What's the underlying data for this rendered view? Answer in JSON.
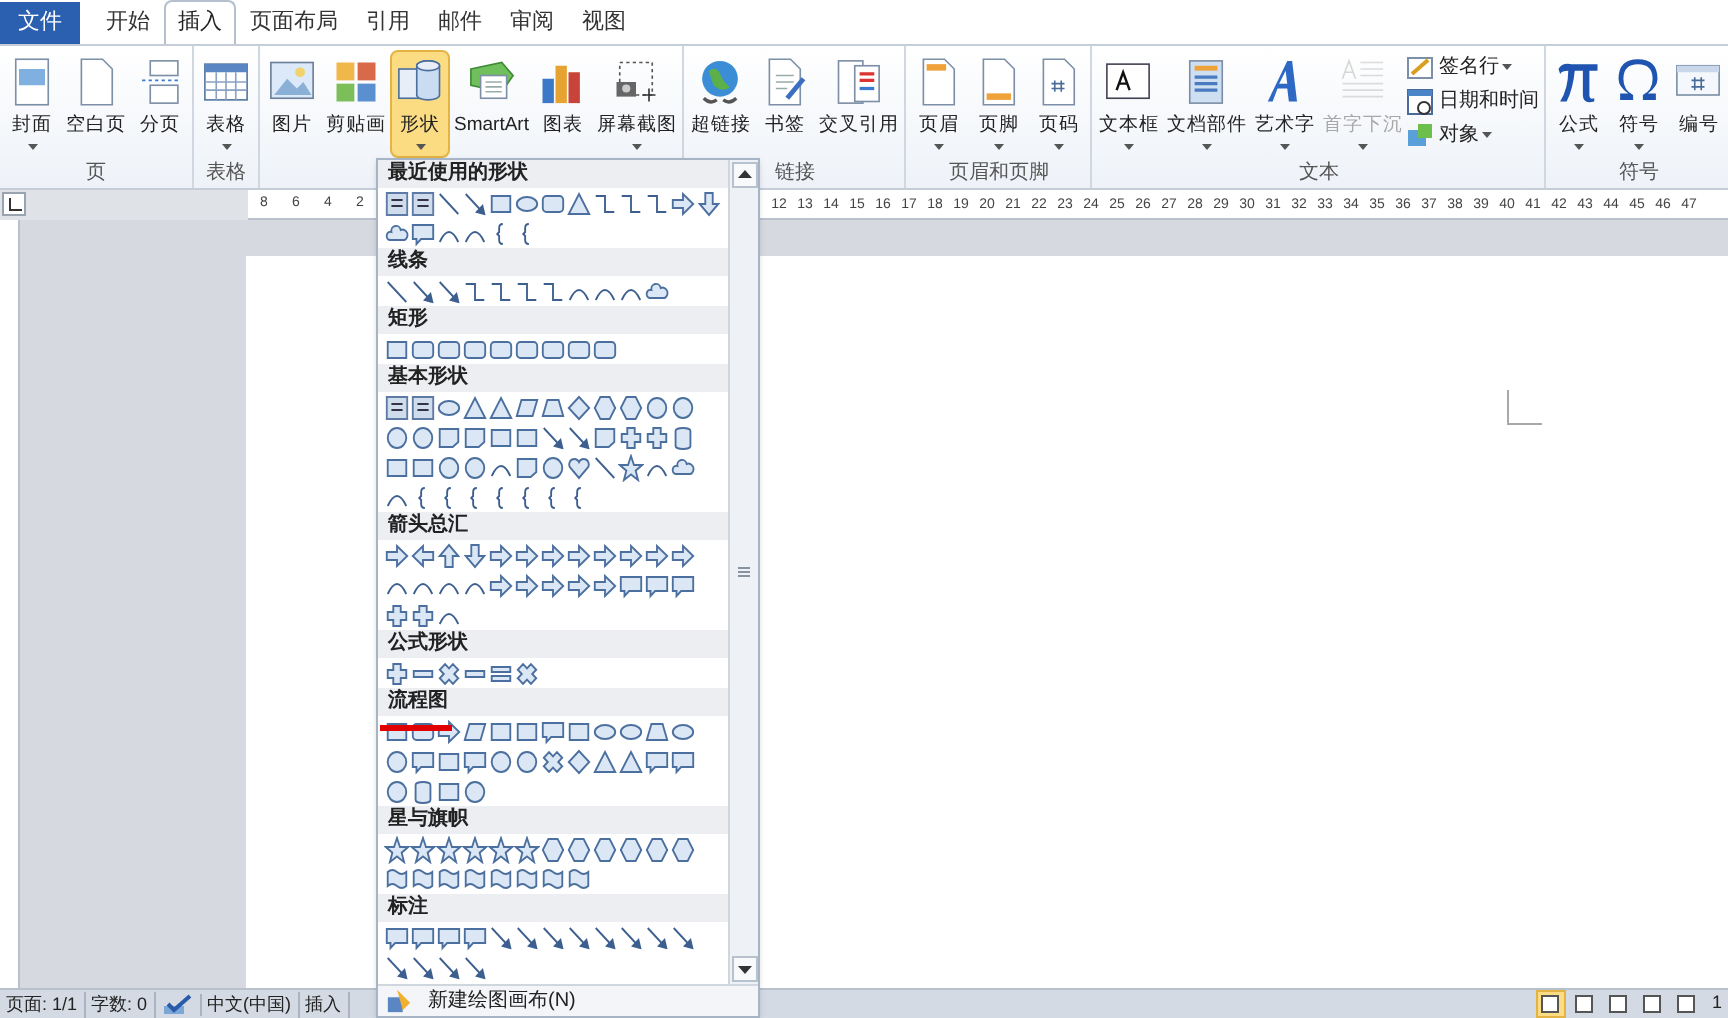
{
  "tabs": [
    {
      "label": "文件",
      "kind": "file",
      "selected": false
    },
    {
      "label": "开始",
      "kind": "tab",
      "selected": false
    },
    {
      "label": "插入",
      "kind": "tab",
      "selected": true
    },
    {
      "label": "页面布局",
      "kind": "tab",
      "selected": false
    },
    {
      "label": "引用",
      "kind": "tab",
      "selected": false
    },
    {
      "label": "邮件",
      "kind": "tab",
      "selected": false
    },
    {
      "label": "审阅",
      "kind": "tab",
      "selected": false
    },
    {
      "label": "视图",
      "kind": "tab",
      "selected": false
    }
  ],
  "ribbon": {
    "groups": [
      {
        "label": "页",
        "buttons": [
          {
            "label": "封面",
            "menu": true,
            "highlighted": false,
            "disabled": false
          },
          {
            "label": "空白页",
            "menu": false,
            "highlighted": false,
            "disabled": false
          },
          {
            "label": "分页",
            "menu": false,
            "highlighted": false,
            "disabled": false
          }
        ]
      },
      {
        "label": "表格",
        "buttons": [
          {
            "label": "表格",
            "menu": true,
            "highlighted": false,
            "disabled": false
          }
        ]
      },
      {
        "buttons": [
          {
            "label": "图片",
            "menu": false,
            "highlighted": false,
            "disabled": false
          },
          {
            "label": "剪贴画",
            "menu": false,
            "highlighted": false,
            "disabled": false
          },
          {
            "label": "形状",
            "menu": true,
            "highlighted": true,
            "disabled": false
          },
          {
            "label": "SmartArt",
            "menu": false,
            "highlighted": false,
            "disabled": false
          },
          {
            "label": "图表",
            "menu": false,
            "highlighted": false,
            "disabled": false
          },
          {
            "label": "屏幕截图",
            "menu": true,
            "highlighted": false,
            "disabled": false
          }
        ]
      },
      {
        "label": "链接",
        "buttons": [
          {
            "label": "超链接",
            "menu": false,
            "highlighted": false,
            "disabled": false
          },
          {
            "label": "书签",
            "menu": false,
            "highlighted": false,
            "disabled": false
          },
          {
            "label": "交叉引用",
            "menu": false,
            "highlighted": false,
            "disabled": false
          }
        ]
      },
      {
        "label": "页眉和页脚",
        "buttons": [
          {
            "label": "页眉",
            "menu": true,
            "highlighted": false,
            "disabled": false
          },
          {
            "label": "页脚",
            "menu": true,
            "highlighted": false,
            "disabled": false
          },
          {
            "label": "页码",
            "menu": true,
            "highlighted": false,
            "disabled": false
          }
        ]
      },
      {
        "label": "文本",
        "buttons": [
          {
            "label": "文本框",
            "menu": true,
            "highlighted": false,
            "disabled": false
          },
          {
            "label": "文档部件",
            "menu": true,
            "highlighted": false,
            "disabled": false
          },
          {
            "label": "艺术字",
            "menu": true,
            "highlighted": false,
            "disabled": false
          },
          {
            "label": "首字下沉",
            "menu": true,
            "highlighted": false,
            "disabled": true
          }
        ],
        "small_buttons": [
          {
            "label": "签名行",
            "menu": true
          },
          {
            "label": "日期和时间",
            "menu": false
          },
          {
            "label": "对象",
            "menu": true
          }
        ]
      },
      {
        "label": "符号",
        "buttons": [
          {
            "label": "公式",
            "menu": true,
            "highlighted": false,
            "disabled": false
          },
          {
            "label": "符号",
            "menu": true,
            "highlighted": false,
            "disabled": false
          },
          {
            "label": "编号",
            "menu": false,
            "highlighted": false,
            "disabled": false
          }
        ]
      }
    ]
  },
  "ruler": {
    "left_numbers": [
      "8",
      "6",
      "4",
      "2"
    ],
    "right_numbers": [
      "12",
      "13",
      "14",
      "15",
      "16",
      "17",
      "18",
      "19",
      "20",
      "21",
      "22",
      "23",
      "24",
      "25",
      "26",
      "27",
      "28",
      "29",
      "30",
      "31",
      "32",
      "33",
      "34",
      "35",
      "36",
      "37",
      "38",
      "39",
      "40",
      "41",
      "42",
      "43",
      "44",
      "45",
      "46",
      "47"
    ]
  },
  "shapes_menu": {
    "sections": [
      {
        "title": "最近使用的形状",
        "kind": "recent"
      },
      {
        "title": "线条",
        "kind": "lines"
      },
      {
        "title": "矩形",
        "kind": "rectangles"
      },
      {
        "title": "基本形状",
        "kind": "basic"
      },
      {
        "title": "箭头总汇",
        "kind": "arrows"
      },
      {
        "title": "公式形状",
        "kind": "equation"
      },
      {
        "title": "流程图",
        "kind": "flowchart"
      },
      {
        "title": "星与旗帜",
        "kind": "stars"
      },
      {
        "title": "标注",
        "kind": "callouts"
      }
    ],
    "footer": "新建绘图画布(N)"
  },
  "status_bar": {
    "items": [
      {
        "label": "页面: 1/1",
        "kind": "text"
      },
      {
        "label": "字数: 0",
        "kind": "text"
      },
      {
        "kind": "proofing"
      },
      {
        "label": "中文(中国)",
        "kind": "text"
      },
      {
        "label": "插入",
        "kind": "text"
      }
    ],
    "views": [
      {
        "selected": true
      },
      {
        "selected": false
      },
      {
        "selected": false
      },
      {
        "selected": false
      },
      {
        "selected": false
      }
    ],
    "zoom": "1"
  }
}
